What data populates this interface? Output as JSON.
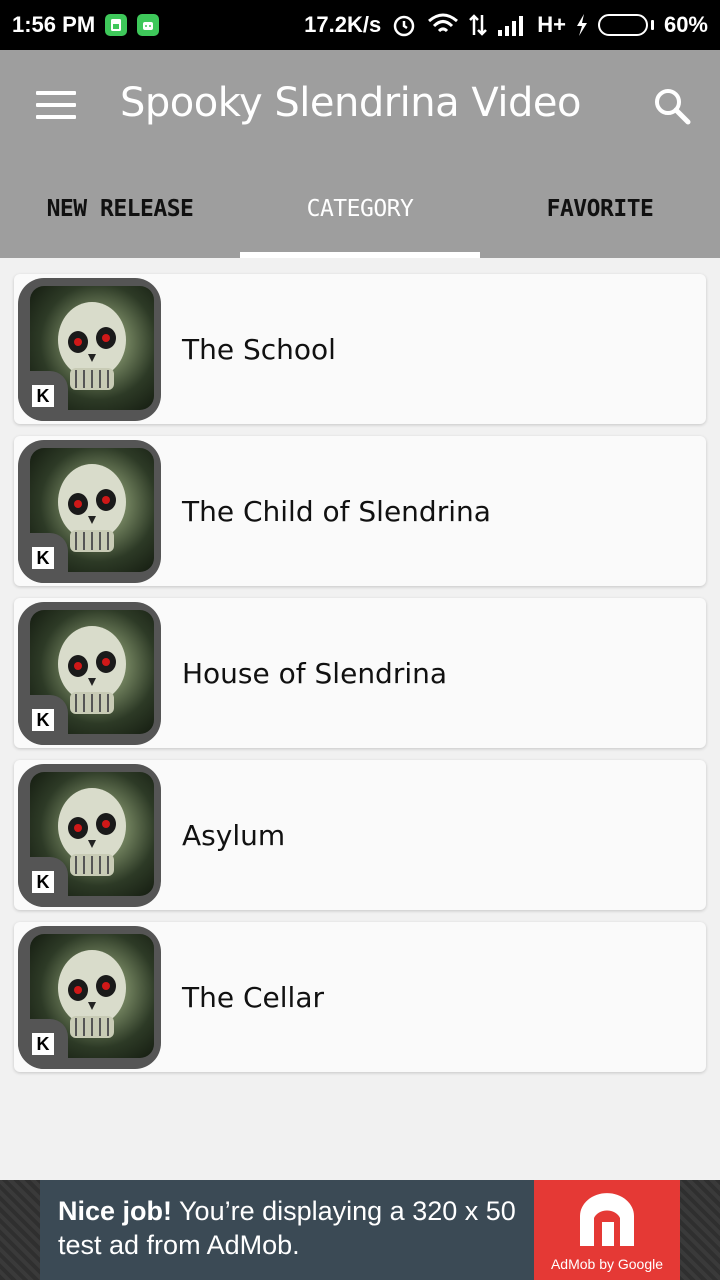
{
  "status_bar": {
    "time": "1:56 PM",
    "net_speed": "17.2K/s",
    "network": "H+",
    "battery_level": 0.6,
    "battery_text": "60%"
  },
  "app_bar": {
    "title": "Spooky Slendrina Video",
    "menu_icon": "hamburger-menu-icon",
    "search_icon": "search-icon"
  },
  "tabs": [
    {
      "label": "NEW RELEASE",
      "active": false
    },
    {
      "label": "CATEGORY",
      "active": true
    },
    {
      "label": "FAVORITE",
      "active": false
    }
  ],
  "categories": [
    {
      "label": "The School"
    },
    {
      "label": "The Child of Slendrina"
    },
    {
      "label": "House of Slendrina"
    },
    {
      "label": "Asylum"
    },
    {
      "label": "The Cellar"
    }
  ],
  "ad": {
    "headline": "Nice job!",
    "body": " You’re displaying a 320 x 50 test ad from AdMob.",
    "logo_text": "AdMob by Google"
  },
  "colors": {
    "app_bar": "#9e9e9e",
    "ad_logo": "#e53935",
    "ad_banner": "#3b4a55"
  }
}
